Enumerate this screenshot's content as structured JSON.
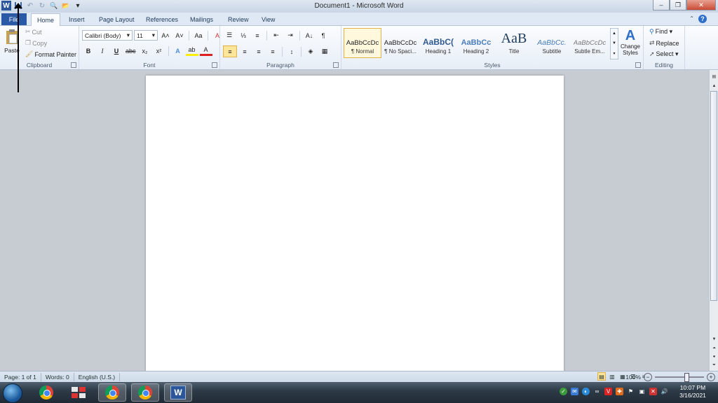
{
  "window": {
    "title": "Document1  -  Microsoft Word",
    "minimize": "–",
    "maximize": "❐",
    "close": "✕"
  },
  "qat": {
    "word_icon": "W",
    "save_icon": "save-icon",
    "undo": "↶",
    "redo": "↻",
    "print_preview": "🔍",
    "open": "📂",
    "customize": "▾"
  },
  "tabs": [
    "File",
    "Home",
    "Insert",
    "Page Layout",
    "References",
    "Mailings",
    "Review",
    "View"
  ],
  "active_tab": "Home",
  "help": "?",
  "clipboard": {
    "paste": "Paste",
    "cut": "Cut",
    "copy": "Copy",
    "format_painter": "Format Painter",
    "label": "Clipboard"
  },
  "font": {
    "name": "Calibri (Body)",
    "size": "11",
    "grow": "A˄",
    "shrink": "A˅",
    "change_case": "Aa",
    "clear": "A",
    "bold": "B",
    "italic": "I",
    "underline": "U",
    "strike": "abc",
    "subscript": "x₂",
    "superscript": "x²",
    "effects": "A",
    "highlight": "ab",
    "color": "A",
    "label": "Font"
  },
  "paragraph": {
    "bullets": "☰",
    "numbering": "⅓",
    "multilevel": "≡",
    "decrease_indent": "⇤",
    "increase_indent": "⇥",
    "sort": "A↓",
    "show_marks": "¶",
    "align_left": "≡",
    "center": "≡",
    "align_right": "≡",
    "justify": "≡",
    "line_spacing": "↕",
    "shading": "◈",
    "borders": "▦",
    "label": "Paragraph"
  },
  "styles": {
    "items": [
      {
        "preview": "AaBbCcDc",
        "name": "¶ Normal"
      },
      {
        "preview": "AaBbCcDc",
        "name": "¶ No Spaci..."
      },
      {
        "preview": "AaBbC(",
        "name": "Heading 1"
      },
      {
        "preview": "AaBbCc",
        "name": "Heading 2"
      },
      {
        "preview": "AaB",
        "name": "Title"
      },
      {
        "preview": "AaBbCc.",
        "name": "Subtitle"
      },
      {
        "preview": "AaBbCcDc",
        "name": "Subtle Em..."
      }
    ],
    "change_styles": "Change Styles",
    "change_styles_line2": "Styles ▾",
    "label": "Styles"
  },
  "editing": {
    "find": "Find ▾",
    "replace": "Replace",
    "select": "Select ▾",
    "label": "Editing"
  },
  "status": {
    "page": "Page: 1 of 1",
    "words": "Words: 0",
    "language": "English (U.S.)",
    "zoom": "100%",
    "zoom_minus": "−",
    "zoom_plus": "+"
  },
  "taskbar": {
    "time": "10:07 PM",
    "date": "3/16/2021"
  },
  "colors": {
    "file_tab": "#2a5aa5",
    "selected_style": "#fde59a",
    "close_button": "#c94b34"
  }
}
